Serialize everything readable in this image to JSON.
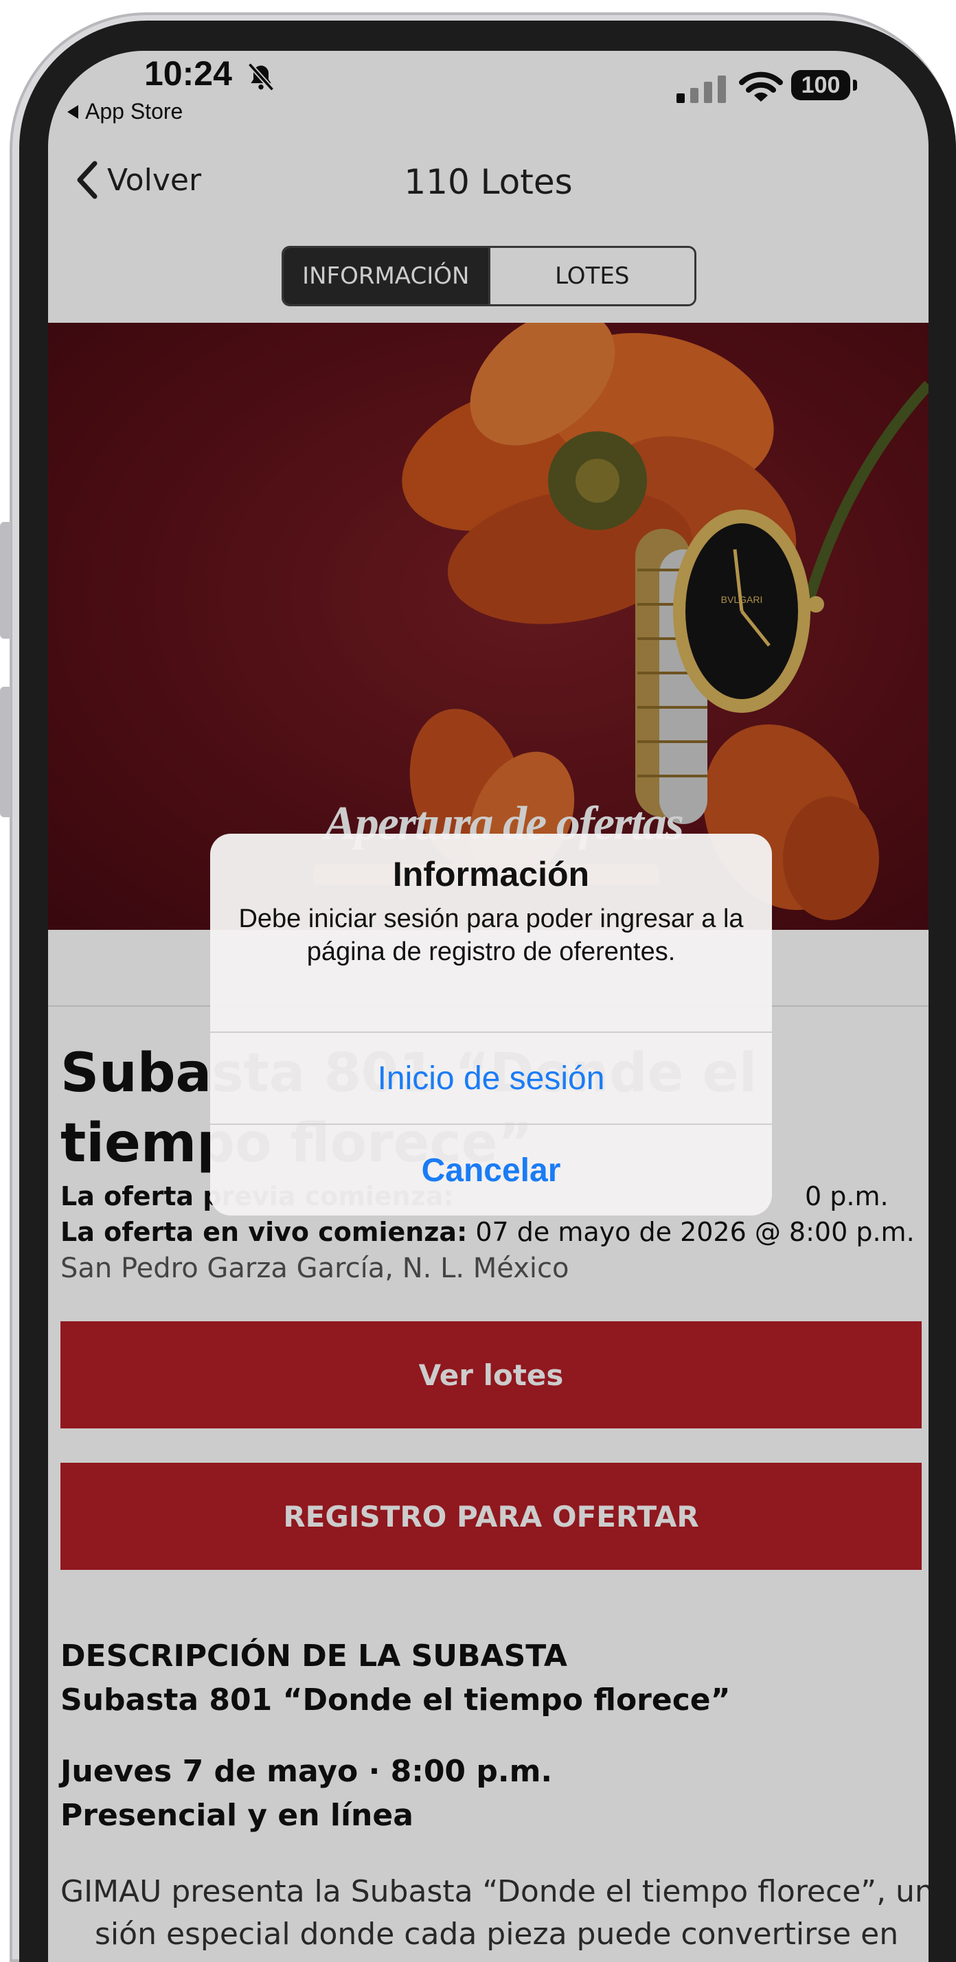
{
  "status_bar": {
    "time": "10:24",
    "back_app": "App Store",
    "battery": "100"
  },
  "nav": {
    "back_label": "Volver",
    "title": "110 Lotes"
  },
  "segments": {
    "info": "INFORMACIÓN",
    "lots": "LOTES"
  },
  "banner": {
    "caption": "Apertura de ofertas"
  },
  "auction": {
    "title": "Subasta 801 “Donde el tiempo florece”",
    "preoffer_label": "La oferta previa comienza:",
    "preoffer_value": "0 p.m.",
    "live_label": "La oferta en vivo comienza:",
    "live_value": "07 de mayo de 2026 @ 8:00 p.m.",
    "location": "San Pedro Garza García, N. L. México",
    "view_lots": "Ver lotes",
    "register": "REGISTRO PARA OFERTAR"
  },
  "description": {
    "heading": "DESCRIPCIÓN DE LA SUBASTA",
    "subtitle": "Subasta 801 “Donde el tiempo florece”",
    "date_line": "Jueves 7 de mayo · 8:00 p.m.",
    "mode_line": "Presencial y en línea",
    "paragraph_1": "GIMAU presenta la Subasta “Donde el tiempo florece”, una",
    "paragraph_2": "sión especial donde cada pieza puede convertirse en"
  },
  "alert": {
    "title": "Información",
    "message": "Debe iniciar sesión para poder ingresar a la página de registro de oferentes.",
    "login": "Inicio de sesión",
    "cancel": "Cancelar"
  },
  "colors": {
    "accent_red": "#b41f27",
    "banner_bg": "#5c1018",
    "alert_link": "#1a7cf5"
  }
}
